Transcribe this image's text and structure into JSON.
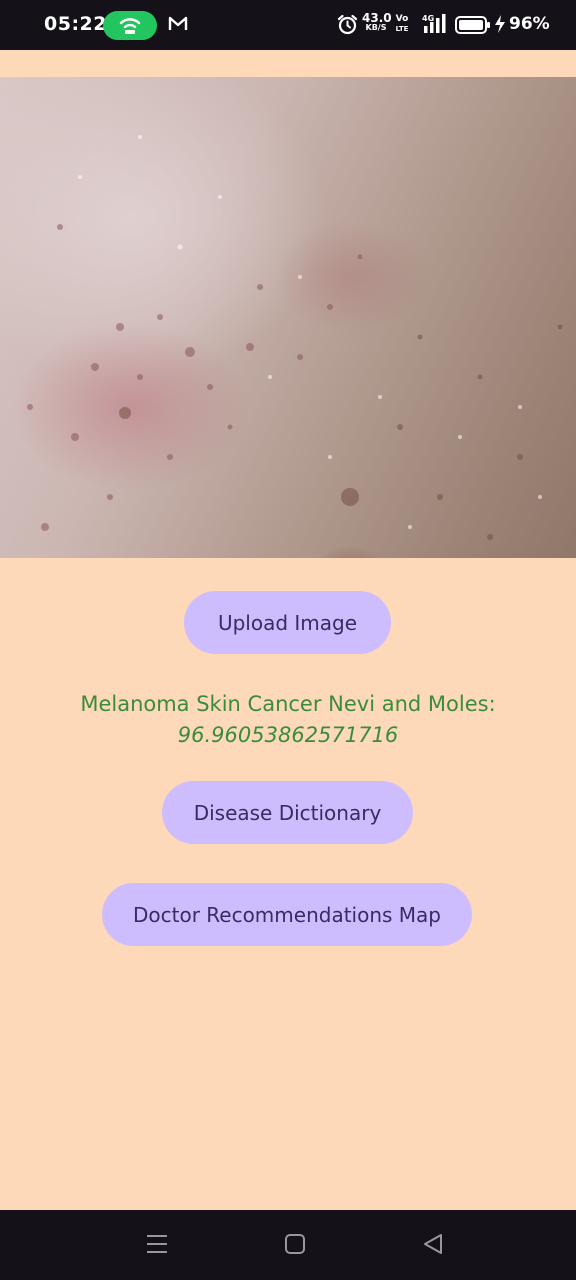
{
  "status_bar": {
    "time": "05:22",
    "net_speed_value": "43.0",
    "net_speed_unit": "KB/S",
    "volte_top": "Vo",
    "volte_bottom": "LTE",
    "network": "4G",
    "battery_percent": "96%",
    "icons": [
      "hotspot-icon",
      "gmail-icon",
      "alarm-icon",
      "signal-icon",
      "battery-icon",
      "charging-bolt-icon"
    ]
  },
  "main": {
    "upload_button_label": "Upload Image",
    "result_label": "Melanoma Skin Cancer Nevi and Moles:",
    "result_value": "96.96053862571716",
    "dictionary_button_label": "Disease Dictionary",
    "map_button_label": "Doctor Recommendations Map"
  },
  "nav_bar": {
    "icons": [
      "recent-apps-icon",
      "home-icon",
      "back-icon"
    ]
  },
  "colors": {
    "background": "#fdd9b9",
    "button_bg": "#cdbdfe",
    "button_text": "#3b2a63",
    "result_text": "#3a8c3c",
    "system_bars": "#141218"
  }
}
